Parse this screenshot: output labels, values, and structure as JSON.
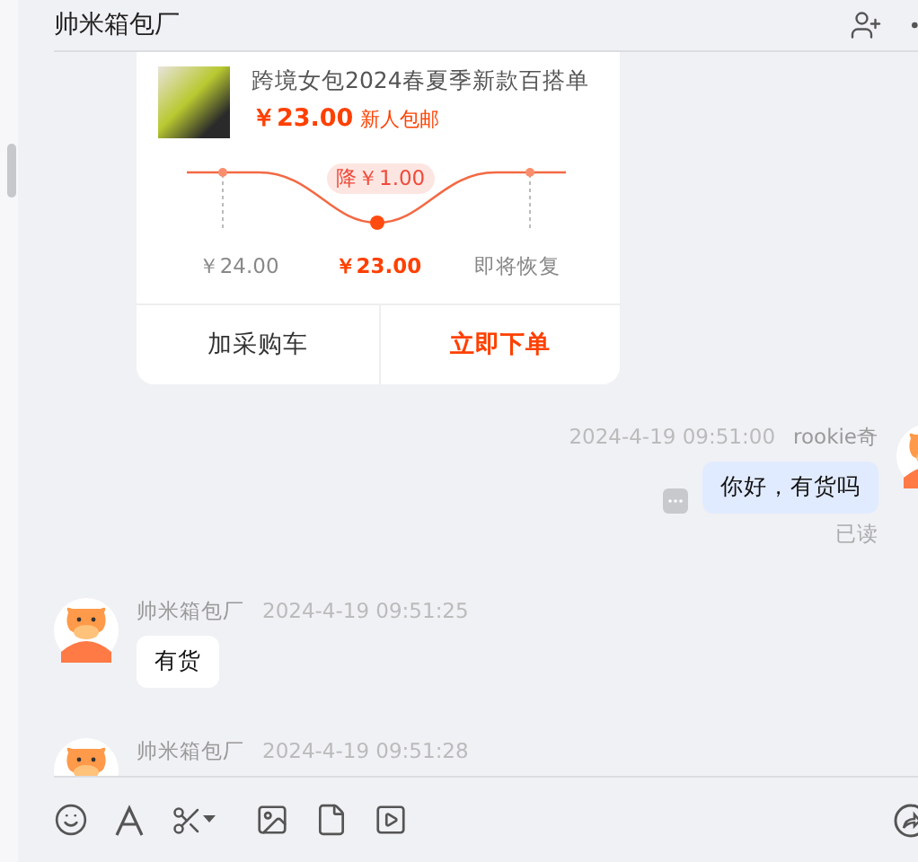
{
  "header": {
    "title": "帅米箱包厂"
  },
  "product_card": {
    "title": "跨境女包2024春夏季新款百搭单",
    "price": "￥23.00",
    "promo": "新人包邮",
    "curve": {
      "badge": "降￥1.00",
      "points": [
        {
          "label": "￥24.00",
          "kind": "past"
        },
        {
          "label": "￥23.00",
          "kind": "current"
        },
        {
          "label": "即将恢复",
          "kind": "future"
        }
      ]
    },
    "buttons": [
      {
        "label": "加采购车",
        "primary": false
      },
      {
        "label": "立即下单",
        "primary": true
      }
    ]
  },
  "messages": [
    {
      "kind": "outgoing",
      "sender": "rookie奇",
      "time": "2024-4-19 09:51:00",
      "text": "你好，有货吗",
      "read_receipt": "已读"
    },
    {
      "kind": "incoming",
      "sender": "帅米箱包厂",
      "time": "2024-4-19 09:51:25",
      "text": "有货"
    },
    {
      "kind": "incoming",
      "sender": "帅米箱包厂",
      "time": "2024-4-19 09:51:28"
    }
  ]
}
